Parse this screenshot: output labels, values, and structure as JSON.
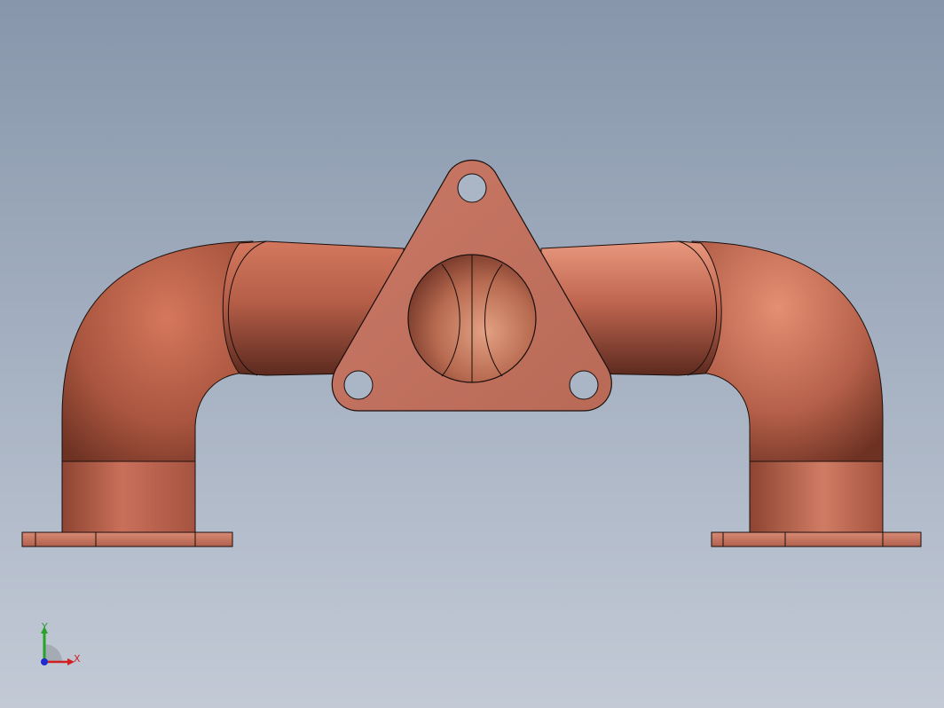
{
  "viewport": {
    "background_top": "#8796ab",
    "background_bottom": "#c3cad6"
  },
  "model": {
    "part": "exhaust-manifold",
    "material_color": "#c3705a",
    "edge_color": "#1a0f0c"
  },
  "triad": {
    "x_label": "X",
    "y_label": "Y",
    "x_color": "#d0201f",
    "y_color": "#27a327",
    "z_color": "#1f2ad0"
  }
}
